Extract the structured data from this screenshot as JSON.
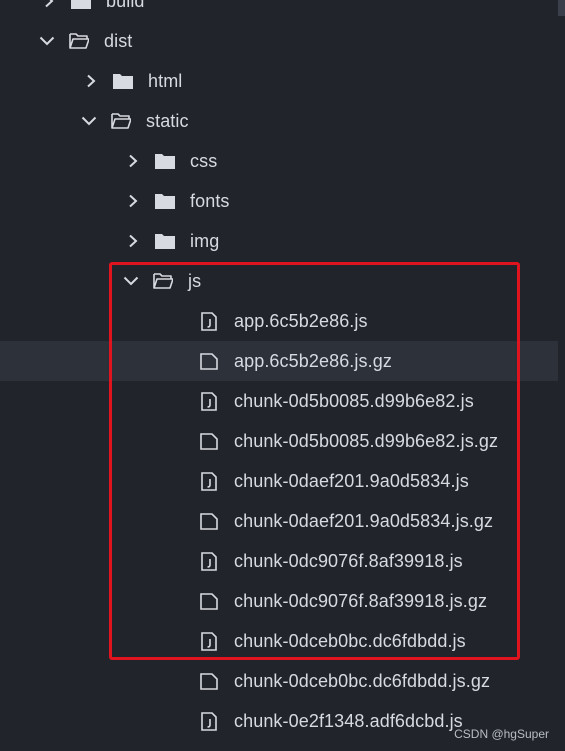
{
  "tree": {
    "build": "build",
    "dist": "dist",
    "html": "html",
    "static": "static",
    "css": "css",
    "fonts": "fonts",
    "img": "img",
    "js": "js",
    "files": [
      "app.6c5b2e86.js",
      "app.6c5b2e86.js.gz",
      "chunk-0d5b0085.d99b6e82.js",
      "chunk-0d5b0085.d99b6e82.js.gz",
      "chunk-0daef201.9a0d5834.js",
      "chunk-0daef201.9a0d5834.js.gz",
      "chunk-0dc9076f.8af39918.js",
      "chunk-0dc9076f.8af39918.js.gz",
      "chunk-0dceb0bc.dc6fdbdd.js",
      "chunk-0dceb0bc.dc6fdbdd.js.gz",
      "chunk-0e2f1348.adf6dcbd.js"
    ]
  },
  "watermark": "CSDN @hgSuper",
  "colors": {
    "highlight": "#e0141e",
    "background": "#21252b",
    "hover_row": "#2c313a"
  },
  "icons": {
    "collapsed": "chevron-right-icon",
    "expanded": "chevron-down-icon",
    "closed_folder": "folder-icon",
    "open_folder": "folder-open-icon",
    "js_file": "js-file-icon",
    "gz_file": "file-icon"
  }
}
